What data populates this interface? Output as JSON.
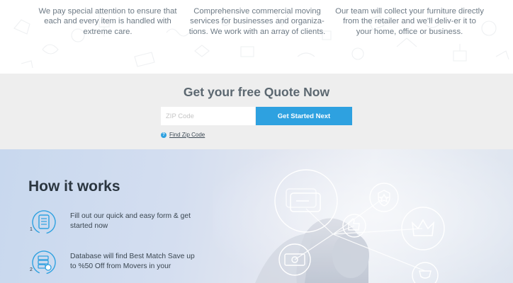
{
  "features": [
    {
      "text": "We pay special attention to ensure that each and every item is handled with extreme care."
    },
    {
      "text": "Comprehensive commercial moving services for businesses and organiza-tions. We work with an array of clients."
    },
    {
      "text": "Our team will collect your furniture directly from the retailer and we’ll deliv-er it to your home, office or business."
    }
  ],
  "quote": {
    "title": "Get your free Quote Now",
    "zip_placeholder": "ZIP Code",
    "button_label": "Get Started Next",
    "find_zip_label": "Find Zip Code"
  },
  "how_it_works": {
    "title": "How it works",
    "steps": [
      {
        "number": "1",
        "text": "Fill out our quick and easy form & get started now",
        "icon": "form-icon"
      },
      {
        "number": "2",
        "text": "Database will find Best Match Save up to %50 Off from Movers in your",
        "icon": "database-icon"
      }
    ]
  },
  "colors": {
    "accent": "#2ea1e0",
    "quote_bg": "#eeeeee",
    "heading": "#2b3640"
  }
}
